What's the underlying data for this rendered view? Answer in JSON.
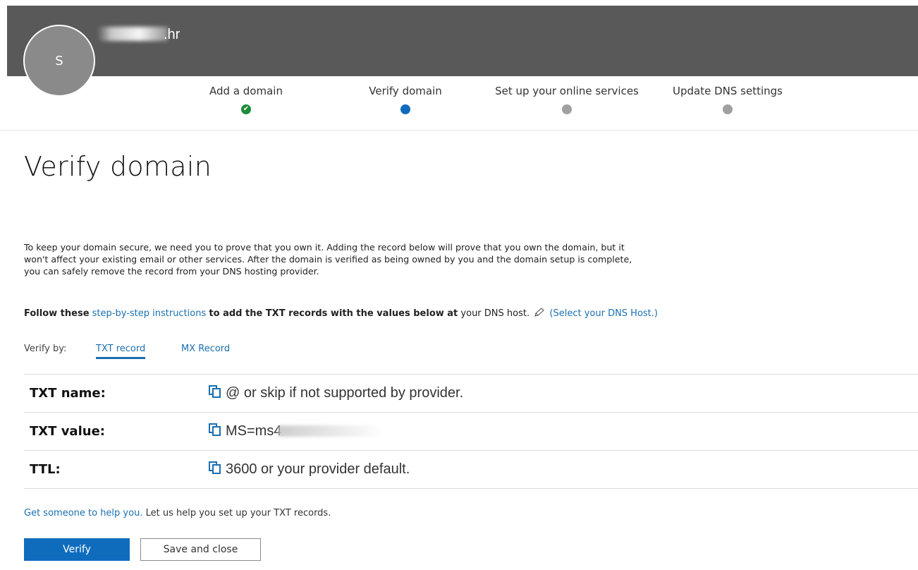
{
  "header": {
    "avatar_initial": "S",
    "domain_suffix": ".hr",
    "background_color": "#595959"
  },
  "steps": [
    {
      "label": "Add a domain",
      "state": "done"
    },
    {
      "label": "Verify domain",
      "state": "current"
    },
    {
      "label": "Set up your online services",
      "state": "pending"
    },
    {
      "label": "Update DNS settings",
      "state": "pending"
    }
  ],
  "page": {
    "title": "Verify domain",
    "intro": "To keep your domain secure, we need you to prove that you own it. Adding the record below will prove that you own the domain, but it won't affect your existing email or other services. After the domain is verified as being owned by you and the domain setup is complete, you can safely remove the record from your DNS hosting provider.",
    "follow_prefix": "Follow these",
    "follow_link": "step-by-step instructions",
    "follow_middle": "to add the TXT records with the values below at",
    "follow_suffix": "your DNS host.",
    "select_host_link": "(Select your DNS Host.)"
  },
  "verify_by": {
    "label": "Verify by:",
    "tabs": [
      {
        "label": "TXT record",
        "active": true
      },
      {
        "label": "MX Record",
        "active": false
      }
    ]
  },
  "records": [
    {
      "label": "TXT name:",
      "value": "@ or skip if not supported by provider."
    },
    {
      "label": "TXT value:",
      "value": "MS=ms4"
    },
    {
      "label": "TTL:",
      "value": "3600 or your provider default."
    }
  ],
  "help": {
    "link": "Get someone to help you.",
    "text": "Let us help you set up your TXT records."
  },
  "buttons": {
    "verify": "Verify",
    "save_close": "Save and close"
  },
  "colors": {
    "accent": "#0f6cbd",
    "done": "#1e8c3a",
    "pending": "#a0a0a0"
  }
}
